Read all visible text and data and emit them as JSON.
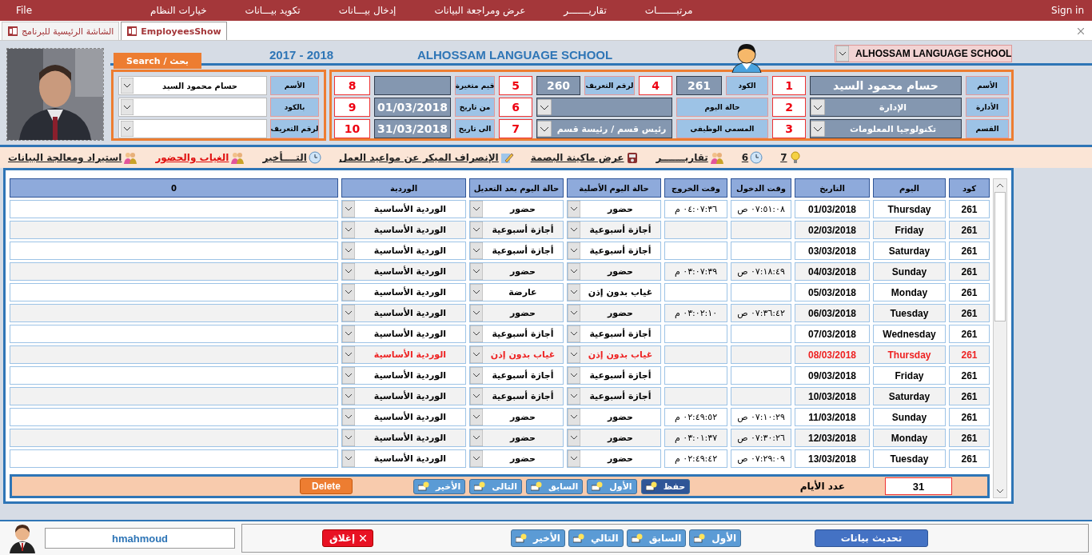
{
  "menu_bar": {
    "file": "File",
    "items": [
      "مرتبـــــــات",
      "تقاريـــــــر",
      "عرض ومراجعة البيانات",
      "إدخال بيـــانات",
      "تكويد بيـــانات",
      "خيارات النظام"
    ],
    "sign_in": "Sign in"
  },
  "tabs": [
    {
      "label": "EmployeesShow",
      "selected": true
    },
    {
      "label": "الشاشة الرئيسية للبرنامج",
      "selected": false
    }
  ],
  "header": {
    "years": "2017 - 2018",
    "school_title": "ALHOSSAM LANGUAGE SCHOOL",
    "school_selector": "ALHOSSAM LANGUAGE SCHOOL"
  },
  "search": {
    "tab": "Search / بحث",
    "rows": [
      {
        "label": "الأسم",
        "value": "حسام محمود السيد"
      },
      {
        "label": "بالكود"
      },
      {
        "label": "لرقم التعريف"
      }
    ]
  },
  "employee_form": {
    "fields": [
      {
        "kind": "value",
        "label": "الأسم",
        "value": "حسام محمود السيد",
        "number": "1"
      },
      {
        "kind": "value",
        "label": "الكود",
        "value": "261",
        "number": "4"
      },
      {
        "kind": "value",
        "label": "لرقم التعريف",
        "value": "260",
        "number": "5"
      },
      {
        "kind": "value",
        "label": "قيم متغيرة",
        "number": "8"
      },
      {
        "kind": "dropdown",
        "label": "الأدارة",
        "value": "الإدارة",
        "number": "2"
      },
      {
        "kind": "dropdown",
        "label": "حالة اليوم",
        "number": "6"
      },
      {
        "kind": "value",
        "label": "من تاريخ",
        "value": "01/03/2018",
        "number": "9"
      },
      {
        "kind": "dropdown",
        "label": "القسم",
        "value": "تكنولوجيا المعلومات",
        "number": "3"
      },
      {
        "kind": "dropdown",
        "label": "المسمى الوظيفى",
        "value": "رئيس قسم / رئيسة قسم",
        "number": "7"
      },
      {
        "kind": "value",
        "label": "الى تاريخ",
        "value": "31/03/2018",
        "number": "10"
      }
    ]
  },
  "report_links": [
    {
      "label": "7",
      "selected": false
    },
    {
      "label": "6",
      "selected": false
    },
    {
      "label": "تقاريـــــــر",
      "selected": false
    },
    {
      "label": "عرض ماكينة البصمة",
      "selected": false
    },
    {
      "label": "الإنصراف الميكر عن مواعيد العمل",
      "selected": false
    },
    {
      "label": "التــــأخير",
      "selected": false
    },
    {
      "label": "الغياب والحضور",
      "selected": true
    },
    {
      "label": "استيراد ومعالجة البيانات",
      "selected": false
    }
  ],
  "table": {
    "columns": [
      "كود",
      "اليوم",
      "التاريخ",
      "وقت الدخول",
      "وقت الخروج",
      "حالة اليوم الأصلية",
      "حالة اليوم بعد التعديل",
      "الوردية",
      "0"
    ],
    "rows": [
      {
        "code": "261",
        "day": "Thursday",
        "date": "01/03/2018",
        "time_in": "٠٧:٥١:٠٨ ص",
        "time_out": "٠٤:٠٧:٣٦ م",
        "original_status": "حضور",
        "adjusted_status": "حضور",
        "shift": "الوردية الأساسية",
        "flagged": false
      },
      {
        "code": "261",
        "day": "Friday",
        "date": "02/03/2018",
        "original_status": "أجازة أسبوعية",
        "adjusted_status": "أجازة أسبوعية",
        "shift": "الوردية الأساسية",
        "flagged": false
      },
      {
        "code": "261",
        "day": "Saturday",
        "date": "03/03/2018",
        "original_status": "أجازة أسبوعية",
        "adjusted_status": "أجازة أسبوعية",
        "shift": "الوردية الأساسية",
        "flagged": false
      },
      {
        "code": "261",
        "day": "Sunday",
        "date": "04/03/2018",
        "time_in": "٠٧:١٨:٤٩ ص",
        "time_out": "٠٣:٠٧:٣٩ م",
        "original_status": "حضور",
        "adjusted_status": "حضور",
        "shift": "الوردية الأساسية",
        "flagged": false
      },
      {
        "code": "261",
        "day": "Monday",
        "date": "05/03/2018",
        "original_status": "غياب بدون إذن",
        "adjusted_status": "عارضة",
        "shift": "الوردية الأساسية",
        "flagged": false
      },
      {
        "code": "261",
        "day": "Tuesday",
        "date": "06/03/2018",
        "time_in": "٠٧:٣٦:٤٢ ص",
        "time_out": "٠٣:٠٢:١٠ م",
        "original_status": "حضور",
        "adjusted_status": "حضور",
        "shift": "الوردية الأساسية",
        "flagged": false
      },
      {
        "code": "261",
        "day": "Wednesday",
        "date": "07/03/2018",
        "original_status": "أجازة أسبوعية",
        "adjusted_status": "أجازة أسبوعية",
        "shift": "الوردية الأساسية",
        "flagged": false
      },
      {
        "code": "261",
        "day": "Thursday",
        "date": "08/03/2018",
        "original_status": "غياب بدون إذن",
        "adjusted_status": "غياب بدون إذن",
        "shift": "الوردية الأساسية",
        "flagged": true
      },
      {
        "code": "261",
        "day": "Friday",
        "date": "09/03/2018",
        "original_status": "أجازة أسبوعية",
        "adjusted_status": "أجازة أسبوعية",
        "shift": "الوردية الأساسية",
        "flagged": false
      },
      {
        "code": "261",
        "day": "Saturday",
        "date": "10/03/2018",
        "original_status": "أجازة أسبوعية",
        "adjusted_status": "أجازة أسبوعية",
        "shift": "الوردية الأساسية",
        "flagged": false
      },
      {
        "code": "261",
        "day": "Sunday",
        "date": "11/03/2018",
        "time_in": "٠٧:١٠:٢٩ ص",
        "time_out": "٠٢:٤٩:٥٢ م",
        "original_status": "حضور",
        "adjusted_status": "حضور",
        "shift": "الوردية الأساسية",
        "flagged": false
      },
      {
        "code": "261",
        "day": "Monday",
        "date": "12/03/2018",
        "time_in": "٠٧:٣٠:٢٦ ص",
        "time_out": "٠٣:٠١:٣٧ م",
        "original_status": "حضور",
        "adjusted_status": "حضور",
        "shift": "الوردية الأساسية",
        "flagged": false
      },
      {
        "code": "261",
        "day": "Tuesday",
        "date": "13/03/2018",
        "time_in": "٠٧:٢٩:٠٩ ص",
        "time_out": "٠٢:٤٩:٤٢ م",
        "original_status": "حضور",
        "adjusted_status": "حضور",
        "shift": "الوردية الأساسية",
        "flagged": false
      }
    ]
  },
  "record_nav": {
    "buttons": [
      {
        "label": "حفظ",
        "kind": "save"
      },
      {
        "label": "الأول",
        "kind": "nav"
      },
      {
        "label": "السابق",
        "kind": "nav"
      },
      {
        "label": "التالى",
        "kind": "nav"
      },
      {
        "label": "الأخير",
        "kind": "nav"
      }
    ],
    "delete": "Delete",
    "days_label": "عدد الأيام",
    "days_count": "31"
  },
  "footer": {
    "user": "hmahmoud",
    "close": "إغلاق",
    "nav": [
      "الأول",
      "السابق",
      "التالي",
      "الأخير"
    ],
    "refresh": "تحديث بيانات"
  }
}
